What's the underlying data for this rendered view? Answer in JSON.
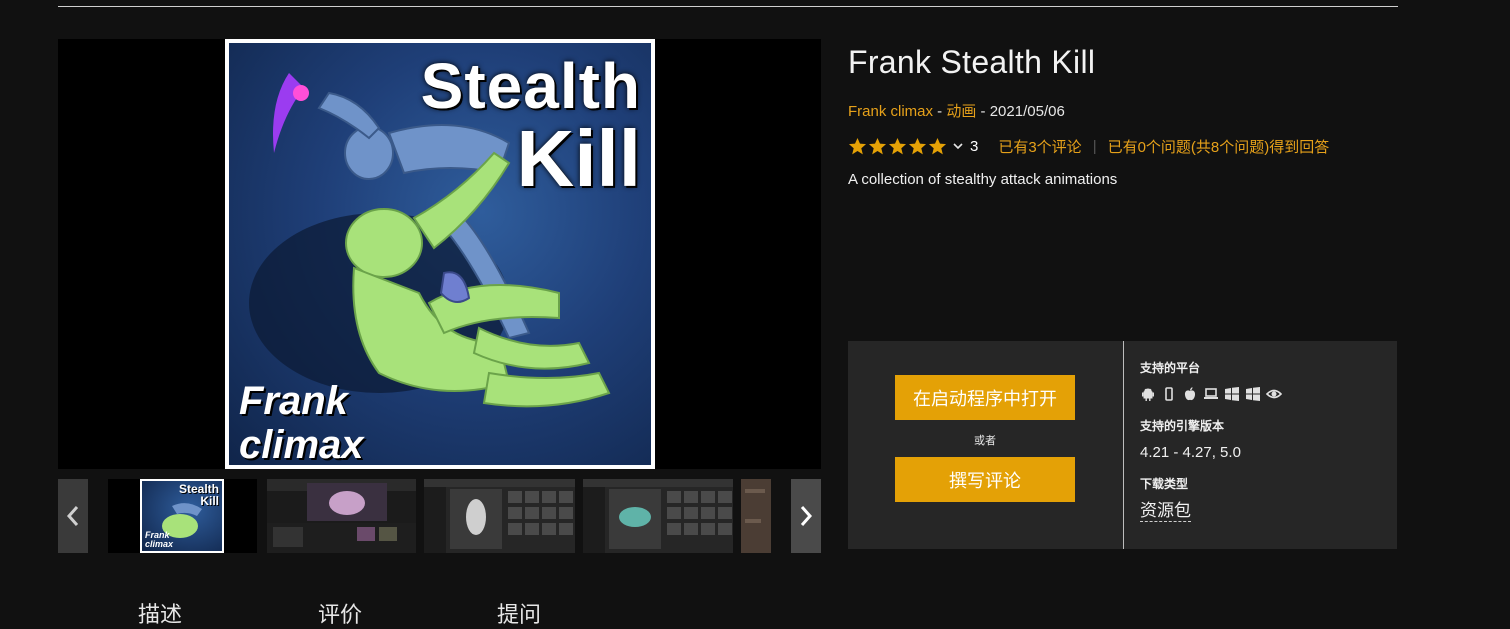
{
  "product": {
    "title": "Frank Stealth Kill",
    "seller": "Frank climax",
    "meta_sep1": " - ",
    "category": "动画",
    "meta_sep2": " - ",
    "date": "2021/05/06",
    "rating": {
      "stars": 5,
      "count": "3",
      "reviews_link": "已有3个评论",
      "questions_link": "已有0个问题(共8个问题)得到回答"
    },
    "description": "A collection of stealthy attack animations"
  },
  "hero_image": {
    "line1": "Stealth",
    "line2": "Kill",
    "line3": "Frank",
    "line4": "climax"
  },
  "thumbnails": [
    {
      "name": "thumbnail-1",
      "line1": "Stealth",
      "line2": "Kill",
      "line3": "Frank",
      "line4": "climax"
    },
    {
      "name": "thumbnail-2"
    },
    {
      "name": "thumbnail-3"
    },
    {
      "name": "thumbnail-4"
    },
    {
      "name": "thumbnail-5"
    }
  ],
  "actions": {
    "open_launcher": "在启动程序中打开",
    "or": "或者",
    "write_review": "撰写评论"
  },
  "specs": {
    "platforms_label": "支持的平台",
    "platforms": [
      "android-icon",
      "ios-device-icon",
      "apple-icon",
      "laptop-icon",
      "windows-icon",
      "windows-icon",
      "vr-eye-icon"
    ],
    "engine_label": "支持的引擎版本",
    "engine_versions": "4.21 - 4.27, 5.0",
    "download_label": "下载类型",
    "download_type": "资源包"
  },
  "tabs": [
    "描述",
    "评价",
    "提问"
  ],
  "colors": {
    "accent": "#e4a106",
    "link": "#e6a11a",
    "background": "#111111",
    "panel": "#262626"
  }
}
